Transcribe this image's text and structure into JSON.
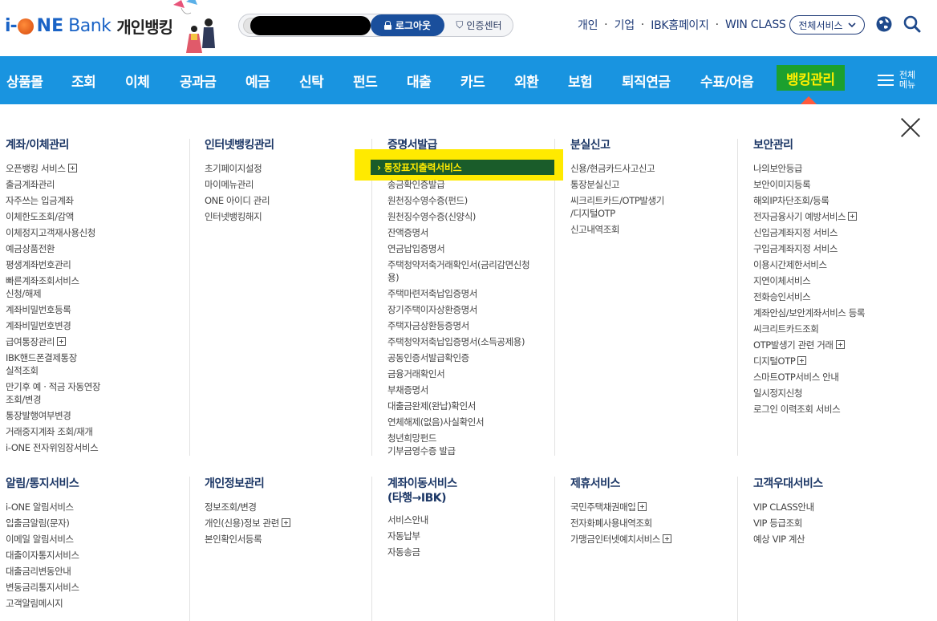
{
  "header": {
    "logo": {
      "part1": "i-",
      "part2": "NE",
      "bank": "Bank",
      "title": "개인뱅킹"
    },
    "logout_label": "로그아웃",
    "cert_label": "인증센터",
    "top_links": [
      "개인",
      "기업",
      "IBK홈페이지",
      "WIN CLASS"
    ],
    "separator": "·",
    "all_services_label": "전체서비스"
  },
  "nav": {
    "items": [
      "상품몰",
      "조회",
      "이체",
      "공과금",
      "예금",
      "신탁",
      "펀드",
      "대출",
      "카드",
      "외환",
      "보험",
      "퇴직연금",
      "수표/어음",
      "뱅킹관리"
    ],
    "active_index": 13,
    "menu_label_1": "전체",
    "menu_label_2": "메뉴"
  },
  "menu": {
    "account": {
      "title": "계좌/이체관리",
      "items": [
        {
          "label": "오픈뱅킹 서비스",
          "plus": true
        },
        {
          "label": "출금계좌관리"
        },
        {
          "label": "자주쓰는 입금계좌"
        },
        {
          "label": "이체한도조회/감액"
        },
        {
          "label": "이체정지고객재사용신청"
        },
        {
          "label": "예금상품전환"
        },
        {
          "label": "평생계좌번호관리"
        },
        {
          "label": "빠른계좌조회서비스\n신청/해제"
        },
        {
          "label": "계좌비밀번호등록"
        },
        {
          "label": "계좌비밀번호변경"
        },
        {
          "label": "급여통장관리",
          "plus": true
        },
        {
          "label": "IBK핸드폰결제통장\n실적조회"
        },
        {
          "label": "만기후 예 · 적금 자동연장\n조회/변경"
        },
        {
          "label": "통장발행여부변경"
        },
        {
          "label": "거래중지계좌 조회/재개"
        },
        {
          "label": "i-ONE 전자위임장서비스"
        }
      ]
    },
    "internet": {
      "title": "인터넷뱅킹관리",
      "items": [
        {
          "label": "초기페이지설정"
        },
        {
          "label": "마이메뉴관리"
        },
        {
          "label": "ONE 아이디 관리"
        },
        {
          "label": "인터넷뱅킹해지"
        }
      ]
    },
    "cert": {
      "title": "증명서발급",
      "highlighted": "통장표지출력서비스",
      "items": [
        {
          "label": "송금확인증발급"
        },
        {
          "label": "원천징수영수증(펀드)"
        },
        {
          "label": "원천징수영수증(신양식)"
        },
        {
          "label": "잔액증명서"
        },
        {
          "label": "연금납입증명서"
        },
        {
          "label": "주택청약저축거래확인서(금리감면신청\n용)"
        },
        {
          "label": "주택마련저축납입증명서"
        },
        {
          "label": "장기주택이자상환증명서"
        },
        {
          "label": "주택자금상환등증명서"
        },
        {
          "label": "주택청약저축납입증명서(소득공제용)"
        },
        {
          "label": "공동인증서발급확인증"
        },
        {
          "label": "금융거래확인서"
        },
        {
          "label": "부채증명서"
        },
        {
          "label": "대출금완제(완납)확인서"
        },
        {
          "label": "연체해제(없음)사실확인서"
        },
        {
          "label": "청년희망펀드\n기부금영수증 발급"
        }
      ]
    },
    "lost": {
      "title": "분실신고",
      "items": [
        {
          "label": "신용/현금카드사고신고"
        },
        {
          "label": "통장분실신고"
        },
        {
          "label": "씨크리트카드/OTP발생기\n/디지털OTP"
        },
        {
          "label": "신고내역조회"
        }
      ]
    },
    "security": {
      "title": "보안관리",
      "items": [
        {
          "label": "나의보안등급"
        },
        {
          "label": "보안이미지등록"
        },
        {
          "label": "해외IP차단조회/등록"
        },
        {
          "label": "전자금융사기 예방서비스",
          "plus": true
        },
        {
          "label": "신입금계좌지정 서비스"
        },
        {
          "label": "구입금계좌지정 서비스"
        },
        {
          "label": "이용시간제한서비스"
        },
        {
          "label": "지연이체서비스"
        },
        {
          "label": "전화승인서비스"
        },
        {
          "label": "계좌안심/보안계좌서비스 등록"
        },
        {
          "label": "씨크리트카드조회"
        },
        {
          "label": "OTP발생기 관련 거래",
          "plus": true
        },
        {
          "label": "디지털OTP",
          "plus": true
        },
        {
          "label": "스마트OTP서비스 안내"
        },
        {
          "label": "일시정지신청"
        },
        {
          "label": "로그인 이력조회 서비스"
        }
      ]
    },
    "notice": {
      "title": "알림/통지서비스",
      "items": [
        {
          "label": "i-ONE 알림서비스"
        },
        {
          "label": "입출금알림(문자)"
        },
        {
          "label": "이메일 알림서비스"
        },
        {
          "label": "대출이자통지서비스"
        },
        {
          "label": "대출금리변동안내"
        },
        {
          "label": "변동금리통지서비스"
        },
        {
          "label": "고객알림메시지"
        }
      ]
    },
    "privacy": {
      "title": "개인정보관리",
      "items": [
        {
          "label": "정보조회/변경"
        },
        {
          "label": "개인(신용)정보 관련",
          "plus": true
        },
        {
          "label": "본인확인서등록"
        }
      ]
    },
    "transfer": {
      "title": "계좌이동서비스\n(타행→IBK)",
      "items": [
        {
          "label": "서비스안내"
        },
        {
          "label": "자동납부"
        },
        {
          "label": "자동송금"
        }
      ]
    },
    "partner": {
      "title": "제휴서비스",
      "items": [
        {
          "label": "국민주택채권매입",
          "plus": true
        },
        {
          "label": "전자화폐사용내역조회"
        },
        {
          "label": "가맹금인터넷예치서비스",
          "plus": true
        }
      ]
    },
    "vip": {
      "title": "고객우대서비스",
      "items": [
        {
          "label": "VIP CLASS안내"
        },
        {
          "label": "VIP 등급조회"
        },
        {
          "label": "예상 VIP 계산"
        }
      ]
    }
  },
  "colors": {
    "nav_bg": "#1994e0",
    "active_bg": "#1ca02e",
    "active_text": "#ffef00",
    "highlight": "#ffea00",
    "title_text": "#1c3766"
  }
}
